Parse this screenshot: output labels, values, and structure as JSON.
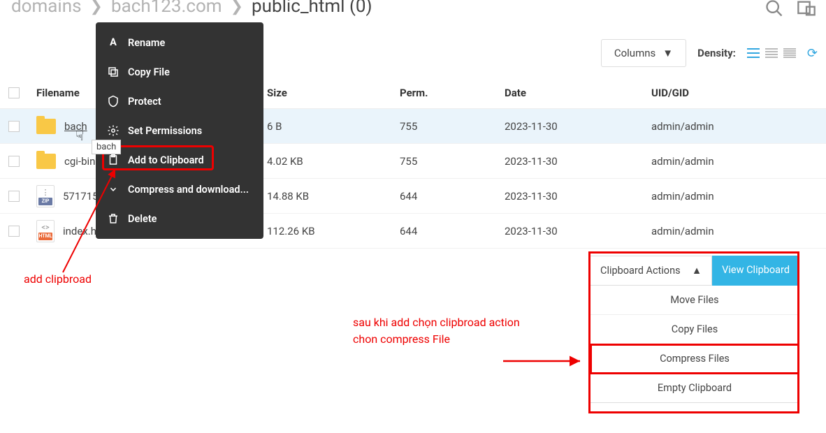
{
  "breadcrumb": {
    "a": "domains",
    "b": "bach123.com",
    "c": "public_html (0)"
  },
  "toolbar": {
    "columns": "Columns",
    "density": "Density:"
  },
  "headers": {
    "filename": "Filename",
    "size": "Size",
    "perm": "Perm.",
    "date": "Date",
    "uidgid": "UID/GID"
  },
  "rows": [
    {
      "name": "bach",
      "size": "6 B",
      "perm": "755",
      "date": "2023-11-30",
      "ug": "admin/admin",
      "type": "folder",
      "sel": true,
      "underline": true
    },
    {
      "name": "cgi-bin",
      "size": "4.02 KB",
      "perm": "755",
      "date": "2023-11-30",
      "ug": "admin/admin",
      "type": "folder"
    },
    {
      "name": "571715",
      "size": "14.88 KB",
      "perm": "644",
      "date": "2023-11-30",
      "ug": "admin/admin",
      "type": "zip"
    },
    {
      "name": "index.html",
      "size": "112.26 KB",
      "perm": "644",
      "date": "2023-11-30",
      "ug": "admin/admin",
      "type": "html"
    }
  ],
  "ctx": {
    "rename": "Rename",
    "copy": "Copy File",
    "protect": "Protect",
    "setperm": "Set Permissions",
    "addclip": "Add to Clipboard",
    "compress": "Compress and download...",
    "delete": "Delete"
  },
  "tooltip": "bach",
  "clip": {
    "actions_label": "Clipboard Actions",
    "view": "View Clipboard",
    "items": {
      "move": "Move Files",
      "copy": "Copy Files",
      "compress": "Compress Files",
      "empty": "Empty Clipboard"
    }
  },
  "annotations": {
    "a1": "add clipbroad",
    "a2a": "sau khi add chọn clipbroad action",
    "a2b": "chon compress File"
  }
}
